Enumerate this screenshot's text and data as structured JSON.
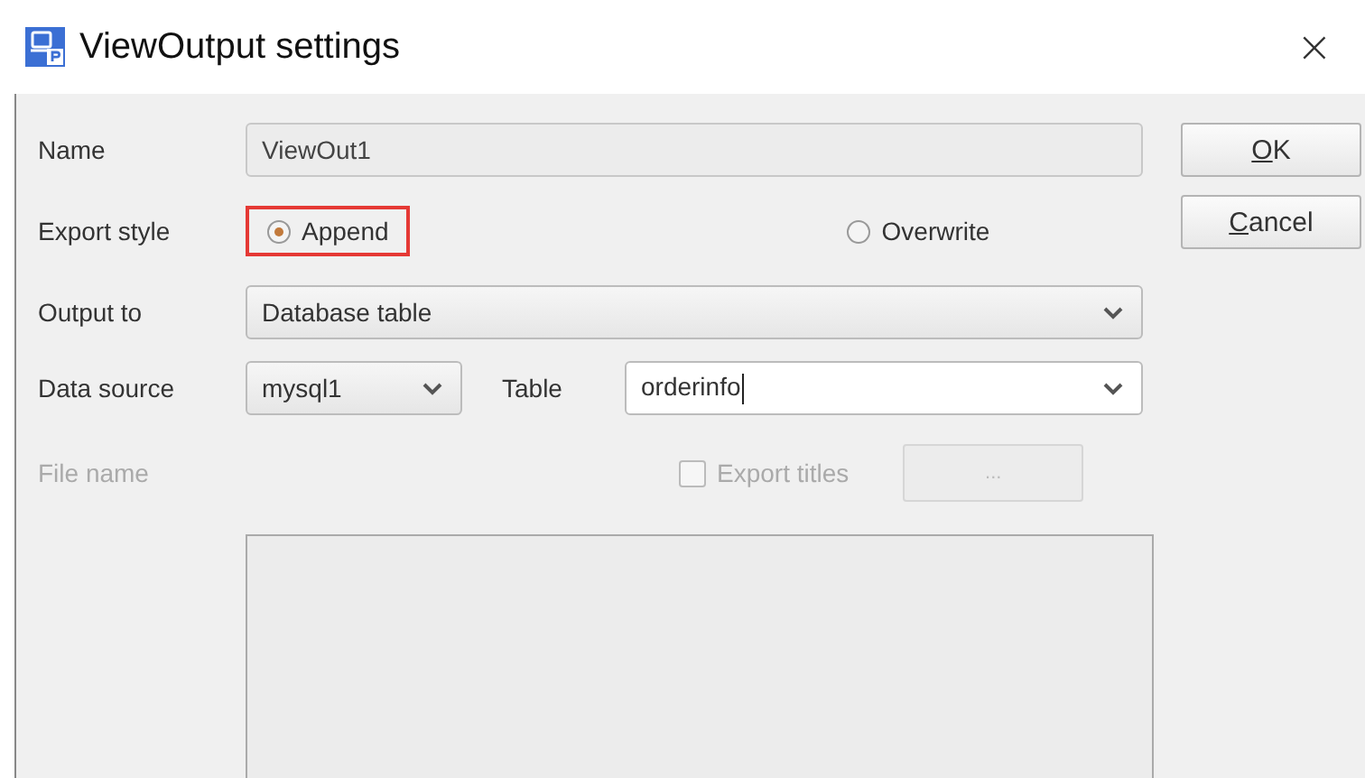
{
  "window": {
    "title": "ViewOutput settings",
    "close": "×"
  },
  "form": {
    "name": {
      "label": "Name",
      "value": "ViewOut1"
    },
    "export_style": {
      "label": "Export style",
      "options": [
        {
          "label": "Append",
          "selected": true,
          "highlighted": true
        },
        {
          "label": "Overwrite",
          "selected": false,
          "highlighted": false
        }
      ]
    },
    "output_to": {
      "label": "Output to",
      "value": "Database table"
    },
    "data_source": {
      "label": "Data source",
      "value": "mysql1"
    },
    "table": {
      "label": "Table",
      "value": "orderinfo",
      "focused": true
    },
    "file_name": {
      "label": "File name",
      "disabled": true
    },
    "export_titles": {
      "label": "Export titles",
      "checked": false,
      "disabled": true
    },
    "browse_button": {
      "label": "...",
      "disabled": true
    }
  },
  "buttons": [
    {
      "label": "OK"
    },
    {
      "label": "Cancel"
    }
  ]
}
